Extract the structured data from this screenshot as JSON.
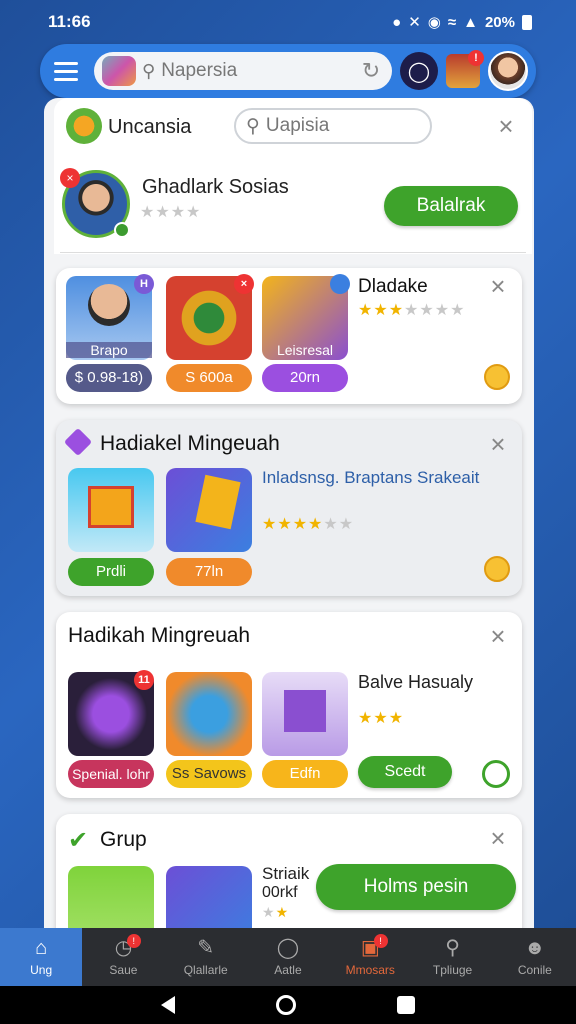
{
  "status": {
    "time": "11:66",
    "battery": "20%"
  },
  "topbar": {
    "search_text": "Napersia"
  },
  "header_card": {
    "title": "Uncansia",
    "search_text": "Uapisia",
    "profile_name": "Ghadlark Sosias",
    "profile_button": "Balalrak"
  },
  "card1": {
    "title": "Dladake",
    "thumbs": [
      {
        "label": "Brapo",
        "pill": "$ 0.98-18)",
        "tag": "H"
      },
      {
        "label": "",
        "pill": "S 600a",
        "tag": "×"
      },
      {
        "label": "Leisresal",
        "pill": "20rn",
        "tag": ""
      }
    ]
  },
  "card2": {
    "title": "Hadiakel Mingeuah",
    "desc": "Inladsnsg. Braptans Srakeait",
    "pills": [
      "Prdli",
      "77ln"
    ]
  },
  "card3": {
    "title": "Hadikah Mingreuah",
    "item_name": "Balve Hasualy",
    "pills": [
      "Spenial. lohr",
      "Ss Savows",
      "Edfn"
    ],
    "button": "Scedt",
    "tag": "11"
  },
  "card4": {
    "title": "Grup",
    "item_name": "Striaik",
    "item_sub": "00rkf",
    "button": "Holms pesin"
  },
  "nav": [
    {
      "label": "Ung",
      "icon": "home-icon",
      "active": true
    },
    {
      "label": "Saue",
      "icon": "clock-icon",
      "badge": true
    },
    {
      "label": "Qlallarle",
      "icon": "pen-icon"
    },
    {
      "label": "Aatle",
      "icon": "chat-icon"
    },
    {
      "label": "Mmosars",
      "icon": "briefcase-icon",
      "badge": true
    },
    {
      "label": "Tpliuge",
      "icon": "search-icon"
    },
    {
      "label": "Conile",
      "icon": "person-icon"
    }
  ],
  "colors": {
    "accent": "#2f7ce0",
    "green": "#3ea32b",
    "nav_active": "#3c79cf"
  }
}
